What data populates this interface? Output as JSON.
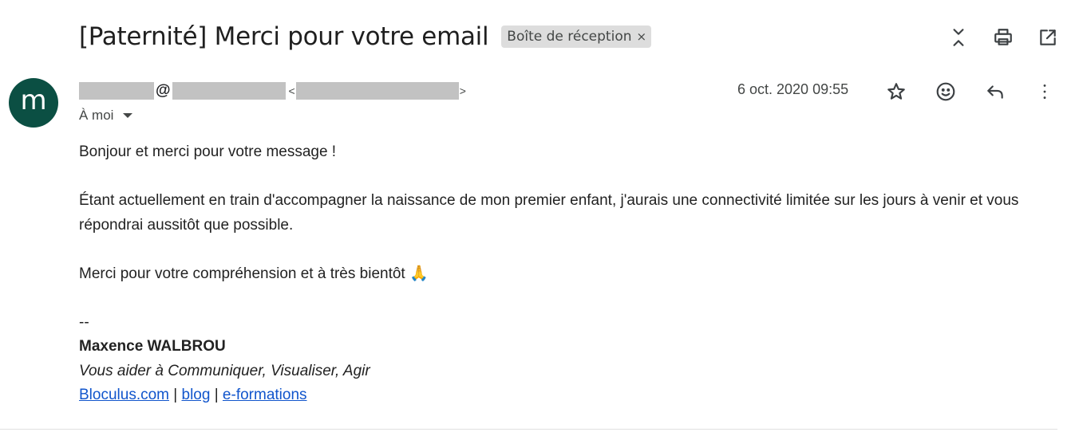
{
  "subject": "[Paternité] Merci pour votre email",
  "label_chip": {
    "text": "Boîte de réception",
    "close": "×"
  },
  "toolbar": {
    "icons": [
      "collapse-icon",
      "print-icon",
      "open-in-new-window-icon"
    ]
  },
  "avatar": {
    "letter": "m",
    "color": "#0b4f43"
  },
  "sender": {
    "at_symbol": "@",
    "lt": "<",
    "gt": ">"
  },
  "recipient": {
    "text": "À moi"
  },
  "date": "6 oct. 2020 09:55",
  "message_icons": [
    "star-icon",
    "emoji-reaction-icon",
    "reply-icon",
    "more-options-icon"
  ],
  "body": {
    "greeting": "Bonjour et merci pour votre message !",
    "paragraph1": "Étant actuellement en train d'accompagner la naissance de mon premier enfant, j'aurais une connectivité limitée sur les jours à venir et vous répondrai aussitôt que possible.",
    "paragraph2": "Merci pour votre compréhension et à très bientôt 🙏",
    "sig_sep": "--",
    "sig_name": "Maxence WALBROU",
    "sig_tagline": "Vous aider à Communiquer, Visualiser, Agir",
    "links": [
      "Bloculus.com",
      "blog",
      "e-formations"
    ],
    "link_separator": "|"
  },
  "colors": {
    "link": "#1155cc",
    "chip_bg": "#dddddd",
    "redaction": "#c2c2c2"
  }
}
